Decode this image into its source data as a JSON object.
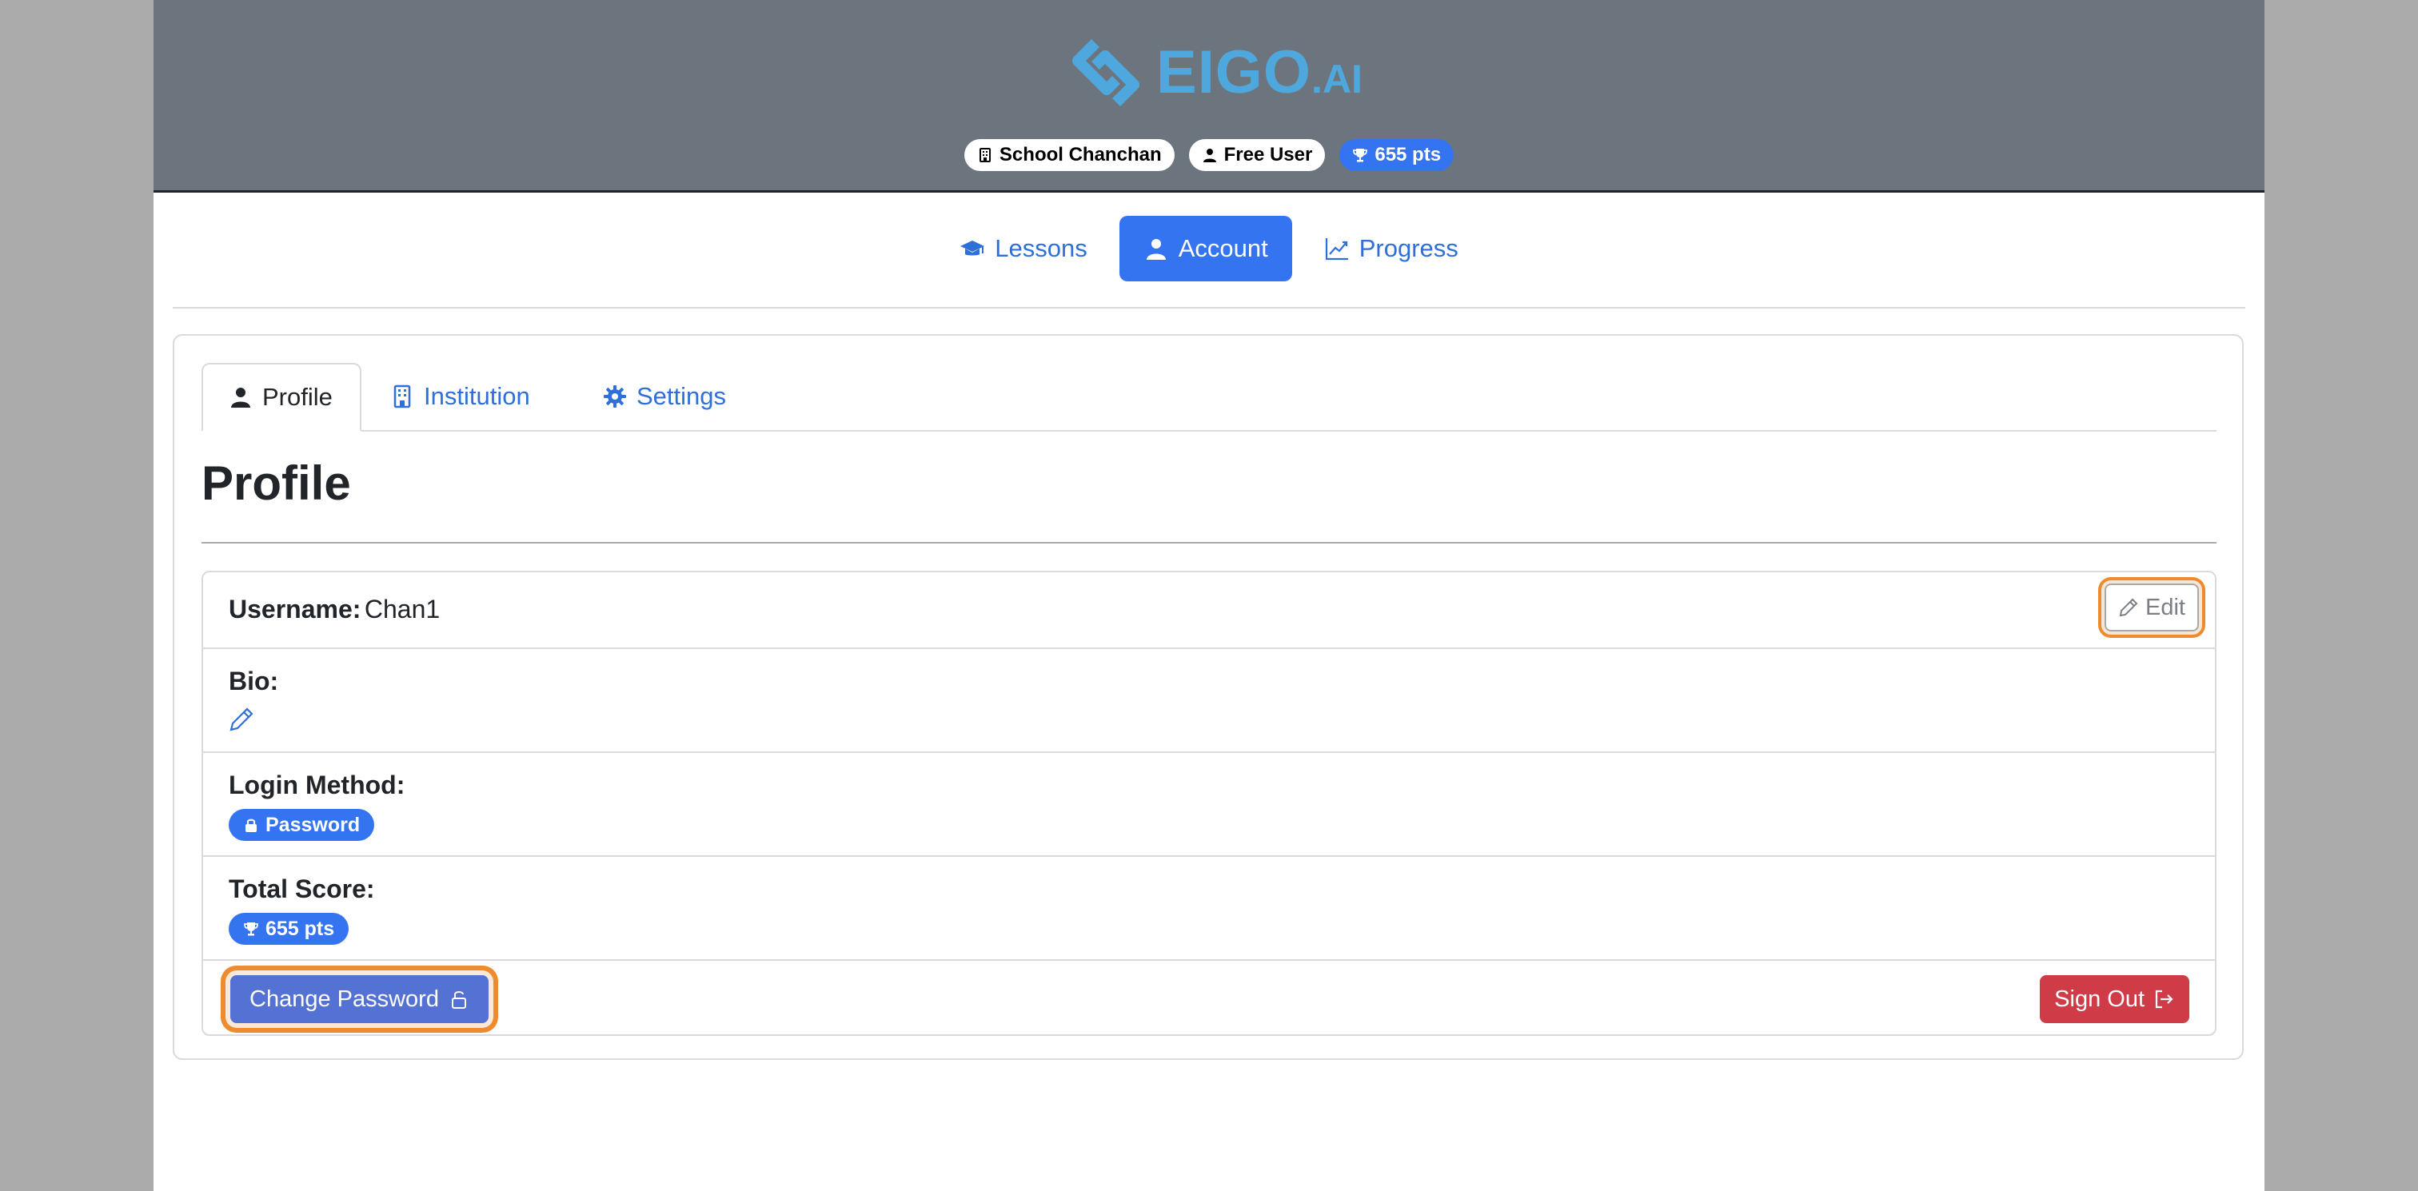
{
  "header": {
    "logo_text": "EIGO",
    "logo_suffix": ".AI",
    "badges": {
      "school": "School Chanchan",
      "plan": "Free User",
      "points": "655 pts"
    }
  },
  "nav": {
    "lessons": "Lessons",
    "account": "Account",
    "progress": "Progress",
    "active": "Account"
  },
  "tabs": {
    "profile": "Profile",
    "institution": "Institution",
    "settings": "Settings",
    "active": "Profile"
  },
  "profile": {
    "title": "Profile",
    "username_label": "Username:",
    "username_value": "Chan1",
    "edit_label": "Edit",
    "bio_label": "Bio:",
    "login_method_label": "Login Method:",
    "login_method_value": "Password",
    "total_score_label": "Total Score:",
    "total_score_value": "655 pts",
    "change_password_label": "Change Password",
    "sign_out_label": "Sign Out"
  },
  "colors": {
    "header_bg": "#6c757d",
    "primary": "#3574f0",
    "danger": "#d03b48",
    "highlight": "#ee8b2f",
    "logo": "#4ea8de"
  },
  "icons": {
    "logo": "diamond-logo-icon",
    "school": "building-icon",
    "user": "person-icon",
    "points": "trophy-icon",
    "lessons": "graduation-cap-icon",
    "progress": "chart-line-icon",
    "settings": "gear-icon",
    "edit": "pencil-icon",
    "lock": "lock-icon",
    "sign_out": "sign-out-icon"
  }
}
